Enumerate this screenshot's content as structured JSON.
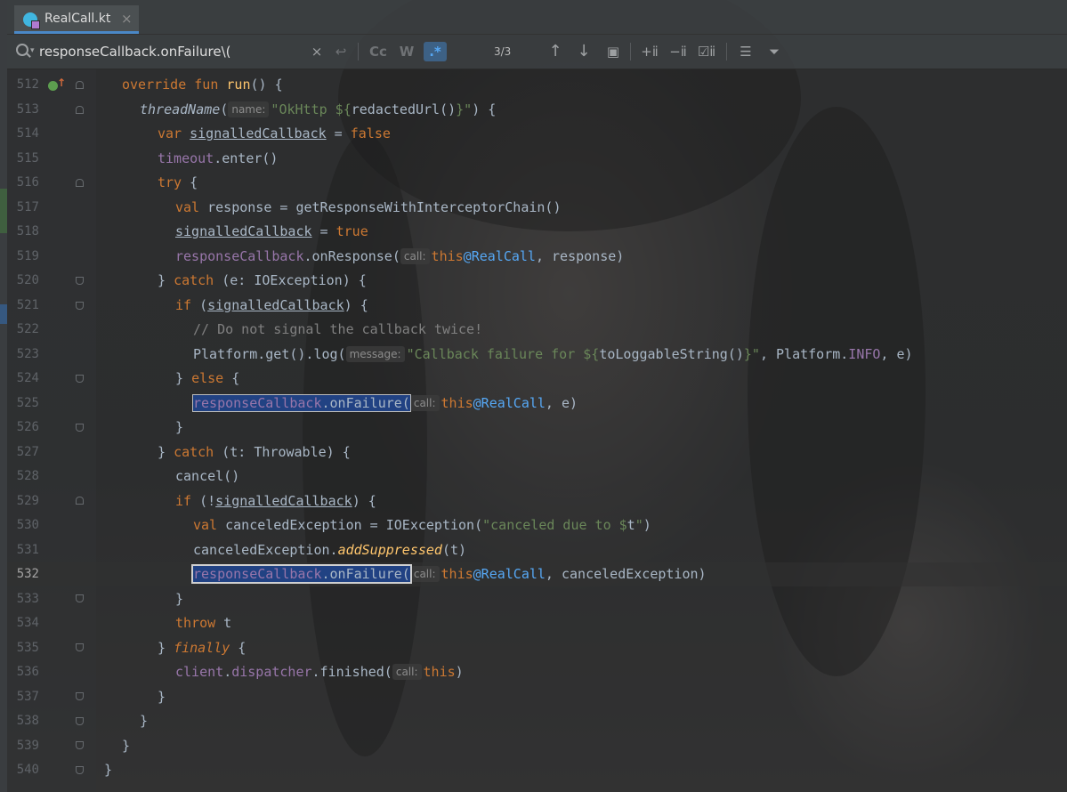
{
  "tab": {
    "title": "RealCall.kt",
    "close": "×"
  },
  "search": {
    "query": "responseCallback.onFailure\\(",
    "clear": "×",
    "match_case": "Cc",
    "words": "W",
    "regex": ".*",
    "count": "3/3",
    "prev": "↑",
    "next": "↓"
  },
  "editor": {
    "line_numbers": [
      "512",
      "513",
      "514",
      "515",
      "516",
      "517",
      "518",
      "519",
      "520",
      "521",
      "522",
      "523",
      "524",
      "525",
      "526",
      "527",
      "528",
      "529",
      "530",
      "531",
      "532",
      "533",
      "534",
      "535",
      "536",
      "537",
      "538",
      "539",
      "540"
    ],
    "hints": {
      "name": "name:",
      "call": "call:",
      "message": "message:"
    },
    "tokens": {
      "override": "override",
      "fun": "fun",
      "run": "run",
      "run_tail": "() {",
      "threadName": "threadName",
      "open_paren": "(",
      "okhttp_str": "\"OkHttp ${",
      "redacted": "redactedUrl()",
      "okhttp_tail": "}\"",
      "close_brace_paren": ") {",
      "var": "var",
      "signalledCallback": "signalledCallback",
      "eq": " = ",
      "false": "false",
      "timeout": "timeout",
      "enter": ".enter()",
      "try": "try",
      "open_brace": " {",
      "val": "val",
      "response_assign": " response = getResponseWithInterceptorChain()",
      "true": "true",
      "responseCallback": "responseCallback",
      "onResponse": ".onResponse(",
      "this": "this",
      "at_realcall": "@RealCall",
      "response_tail": ", response)",
      "close_brace": "}",
      "catch": "catch",
      "ioexception": " (e: IOException) {",
      "if": "if",
      "if_open": " (",
      "if_close": ") {",
      "comment": "// Do not signal the callback twice!",
      "platform_log": "Platform.get().log(",
      "callback_failure_str": "\"Callback failure for ${",
      "toLoggable": "toLoggableString()",
      "log_str_tail": "}\"",
      "platform_info_pre": ", Platform.",
      "INFO": "INFO",
      "log_tail": ", e)",
      "else": "else",
      "onFailure": "responseCallback.onFailure(",
      "e_tail": ", e)",
      "throwable": " (t: Throwable) {",
      "cancel": "cancel()",
      "if_not": " (!",
      "canceled_assign": " canceledException = IOException(",
      "canceled_str": "\"canceled due to $",
      "canceled_t": "t",
      "canceled_str_end": "\"",
      "canceled_close": ")",
      "canceled_ex": "canceledException.",
      "addSuppressed": "addSuppressed",
      "t_paren": "(t)",
      "canceled_tail": ", canceledException)",
      "throw": "throw",
      "throw_t": " t",
      "finally": "finally",
      "client": "client",
      "dispatcher": "dispatcher",
      "finished": ".finished(",
      "close_paren": ")",
      "dot": "."
    }
  },
  "colors": {
    "keyword": "#cc7832",
    "function": "#ffc66d",
    "string": "#6a8759",
    "property": "#9876aa",
    "label": "#56a8f5",
    "comment": "#808080",
    "match": "#214283"
  }
}
